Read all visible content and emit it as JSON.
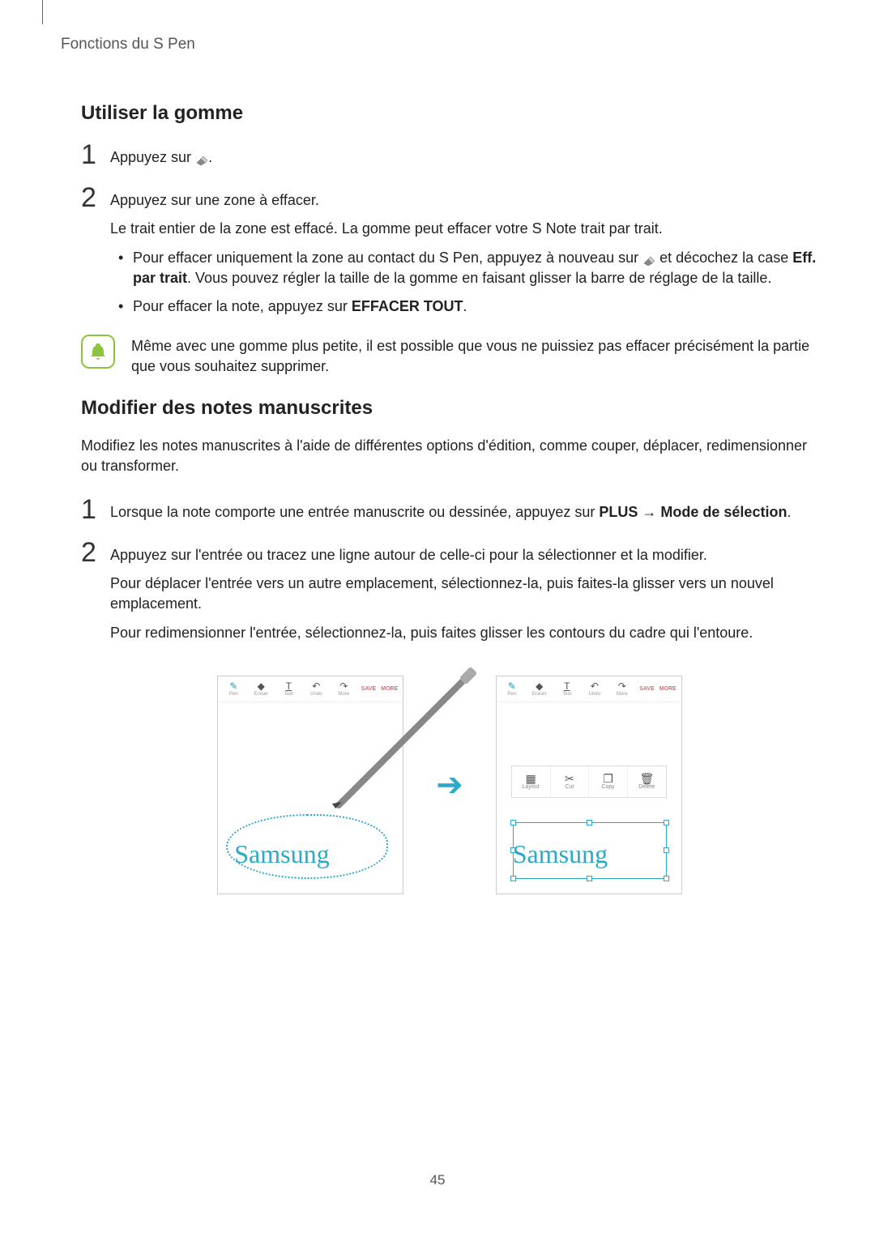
{
  "header": "Fonctions du S Pen",
  "section1": {
    "title": "Utiliser la gomme",
    "step1": {
      "num": "1",
      "text_before_icon": "Appuyez sur ",
      "text_after_icon": "."
    },
    "step2": {
      "num": "2",
      "line1": "Appuyez sur une zone à effacer.",
      "line2": "Le trait entier de la zone est effacé. La gomme peut effacer votre S Note trait par trait.",
      "bullet1_before": "Pour effacer uniquement la zone au contact du S Pen, appuyez à nouveau sur ",
      "bullet1_after": " et décochez la case ",
      "bullet1_bold": "Eff. par trait",
      "bullet1_tail": ". Vous pouvez régler la taille de la gomme en faisant glisser la barre de réglage de la taille.",
      "bullet2_before": "Pour effacer la note, appuyez sur ",
      "bullet2_bold": "EFFACER TOUT",
      "bullet2_after": "."
    },
    "note": "Même avec une gomme plus petite, il est possible que vous ne puissiez pas effacer précisément la partie que vous souhaitez supprimer."
  },
  "section2": {
    "title": "Modifier des notes manuscrites",
    "intro": "Modifiez les notes manuscrites à l'aide de différentes options d'édition, comme couper, déplacer, redimensionner ou transformer.",
    "step1": {
      "num": "1",
      "before": "Lorsque la note comporte une entrée manuscrite ou dessinée, appuyez sur ",
      "b1": "PLUS",
      "arrow": " → ",
      "b2": "Mode de sélection",
      "after": "."
    },
    "step2": {
      "num": "2",
      "line1": "Appuyez sur l'entrée ou tracez une ligne autour de celle-ci pour la sélectionner et la modifier.",
      "line2": "Pour déplacer l'entrée vers un autre emplacement, sélectionnez-la, puis faites-la glisser vers un nouvel emplacement.",
      "line3": "Pour redimensionner l'entrée, sélectionnez-la, puis faites glisser les contours du cadre qui l'entoure."
    }
  },
  "figure": {
    "toolbar": {
      "pen": "Pen",
      "eraser": "Eraser",
      "text": "Text",
      "undo": "Undo",
      "redo": "More",
      "save": "SAVE",
      "more": "MORE"
    },
    "context": {
      "layout": "Layout",
      "cut": "Cut",
      "copy": "Copy",
      "delete": "Delete"
    },
    "handwriting": "Samsung"
  },
  "page_number": "45"
}
